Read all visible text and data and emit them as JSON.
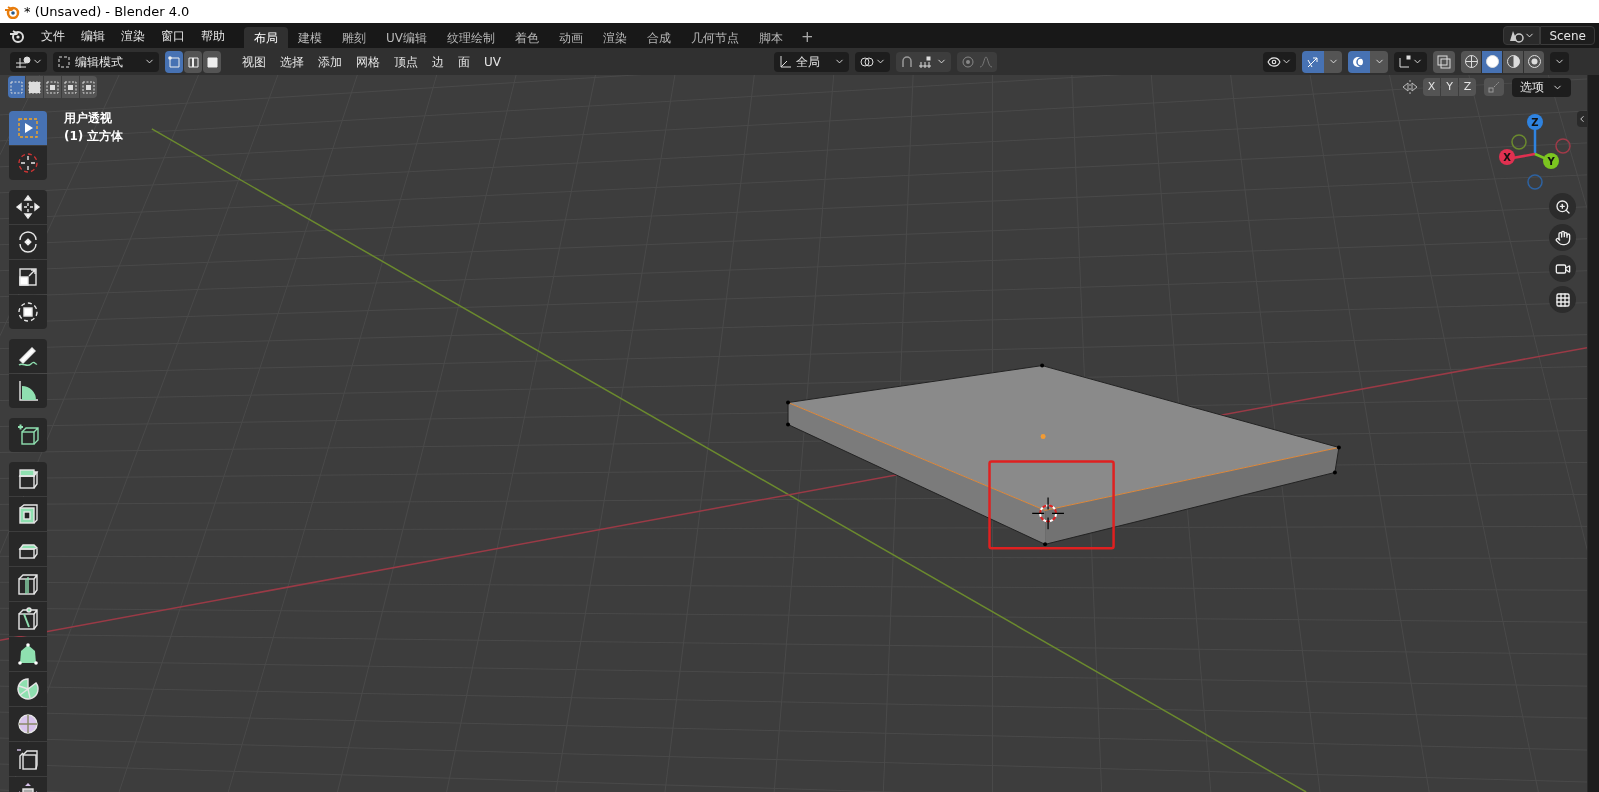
{
  "window": {
    "title": "* (Unsaved) - Blender 4.0"
  },
  "menu": [
    "文件",
    "编辑",
    "渲染",
    "窗口",
    "帮助"
  ],
  "workspaces": [
    {
      "label": "布局",
      "selected": true
    },
    {
      "label": "建模",
      "selected": false
    },
    {
      "label": "雕刻",
      "selected": false
    },
    {
      "label": "UV编辑",
      "selected": false
    },
    {
      "label": "纹理绘制",
      "selected": false
    },
    {
      "label": "着色",
      "selected": false
    },
    {
      "label": "动画",
      "selected": false
    },
    {
      "label": "渲染",
      "selected": false
    },
    {
      "label": "合成",
      "selected": false
    },
    {
      "label": "几何节点",
      "selected": false
    },
    {
      "label": "脚本",
      "selected": false
    }
  ],
  "add_workspace": "+",
  "scene": "Scene",
  "header": {
    "mode": "编辑模式",
    "select_modes": [
      {
        "selected": true
      },
      {
        "selected": false
      },
      {
        "selected": false
      }
    ],
    "menus": [
      "视图",
      "选择",
      "添加",
      "网格",
      "顶点",
      "边",
      "面",
      "UV"
    ],
    "orientation": "全局",
    "snap_on": false,
    "proportional_edit": false,
    "overlays_on": true,
    "xray": false,
    "shading": [
      {
        "selected": false
      },
      {
        "selected": true
      },
      {
        "selected": false
      },
      {
        "selected": false
      }
    ]
  },
  "subheader": {
    "box_modes": [
      {
        "selected": true
      },
      {
        "selected": false
      },
      {
        "selected": false
      },
      {
        "selected": false
      },
      {
        "selected": false
      }
    ],
    "axes": [
      "X",
      "Y",
      "Z"
    ],
    "options": "选项"
  },
  "viewport": {
    "view_name": "用户透视",
    "object": "(1) 立方体"
  },
  "gizmo": {
    "z": "Z",
    "x": "X",
    "y": "Y"
  },
  "tool_groups": [
    {
      "tools": [
        {
          "kind": "select",
          "selected": true
        },
        {
          "kind": "cursor",
          "selected": false
        }
      ]
    },
    {
      "tools": [
        {
          "kind": "move",
          "selected": false
        },
        {
          "kind": "rotate",
          "selected": false
        },
        {
          "kind": "scale",
          "selected": false
        },
        {
          "kind": "transform",
          "selected": false
        }
      ]
    },
    {
      "tools": [
        {
          "kind": "annotate",
          "selected": false
        },
        {
          "kind": "measure",
          "selected": false
        }
      ]
    },
    {
      "tools": [
        {
          "kind": "add-cube",
          "selected": false
        }
      ]
    },
    {
      "tools": [
        {
          "kind": "extrude",
          "selected": false
        },
        {
          "kind": "inset",
          "selected": false
        },
        {
          "kind": "bevel",
          "selected": false
        },
        {
          "kind": "loop-cut",
          "selected": false
        },
        {
          "kind": "knife",
          "selected": false
        },
        {
          "kind": "poly-build",
          "selected": false
        },
        {
          "kind": "spin",
          "selected": false
        },
        {
          "kind": "smooth",
          "selected": false
        },
        {
          "kind": "edge-slide",
          "selected": false
        },
        {
          "kind": "shrink",
          "selected": false
        }
      ]
    }
  ]
}
